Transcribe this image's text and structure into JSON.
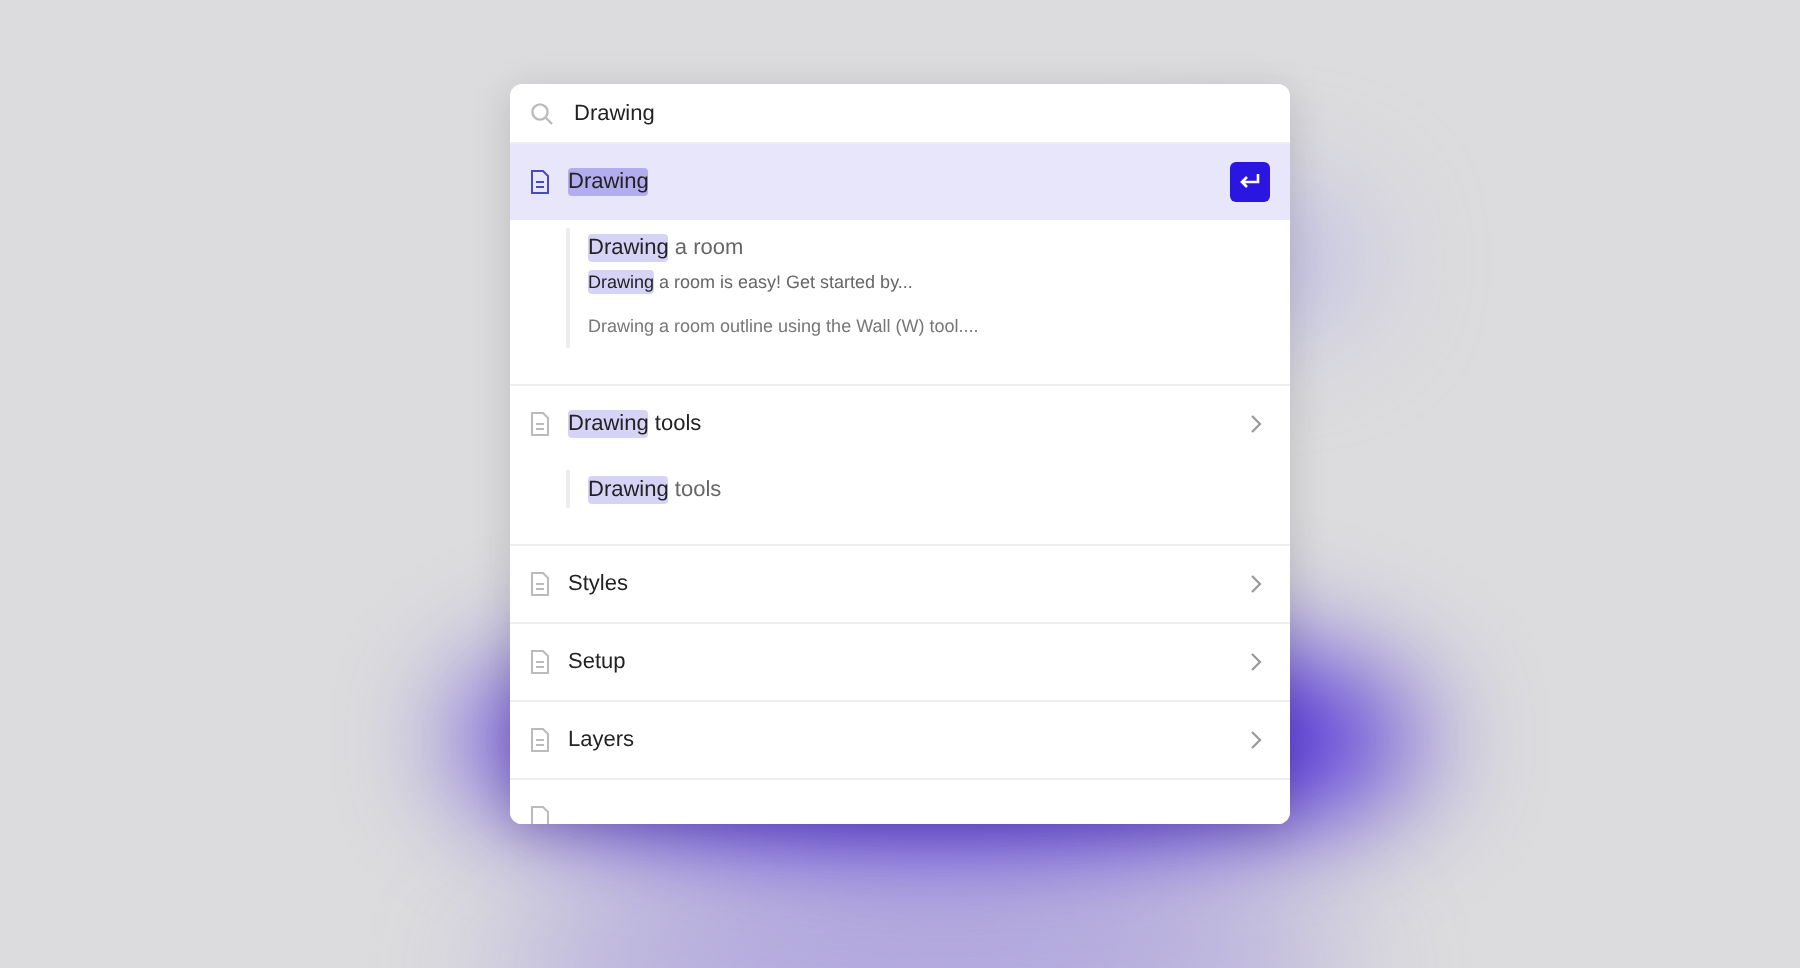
{
  "search": {
    "value": "Drawing"
  },
  "results": [
    {
      "match": "Drawing",
      "selected": true,
      "excerpts": [
        {
          "kind": "heading",
          "match": "Drawing",
          "rest": " a room"
        },
        {
          "kind": "snippet",
          "match": "Drawing",
          "rest": " a room is easy! Get started by..."
        },
        {
          "kind": "snippet",
          "rest": "Drawing a room outline using the Wall (W) tool...."
        }
      ]
    },
    {
      "match": "Drawing",
      "rest": " tools",
      "selected": false,
      "excerpts": [
        {
          "kind": "heading",
          "match": "Drawing",
          "rest": " tools"
        }
      ]
    },
    {
      "rest": "Styles",
      "selected": false
    },
    {
      "rest": "Setup",
      "selected": false
    },
    {
      "rest": "Layers",
      "selected": false
    }
  ],
  "more_below": true
}
